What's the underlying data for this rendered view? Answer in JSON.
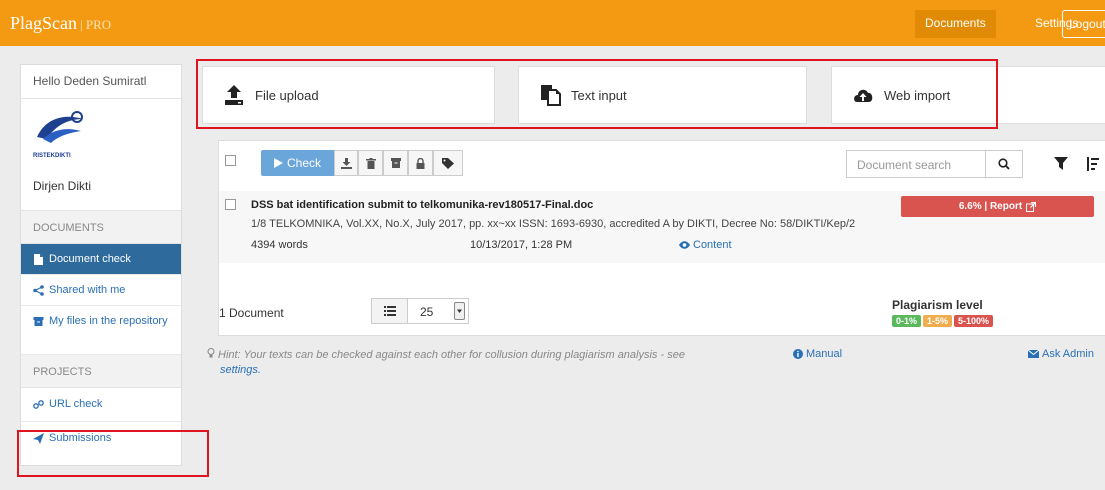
{
  "app": {
    "logo_text": "PlagScan",
    "logo_suffix": "| PRO"
  },
  "topnav": {
    "documents": "Documents",
    "settings": "Settings",
    "logout": "Logout"
  },
  "sidebar": {
    "greeting": "Hello Deden Sumiratl",
    "org_logo_text": "RISTEKDIKTI",
    "org_name": "Dirjen Dikti",
    "documents_header": "DOCUMENTS",
    "items": [
      {
        "label": "Document check",
        "icon": "file-icon",
        "active": true
      },
      {
        "label": "Shared with me",
        "icon": "share-icon",
        "active": false
      },
      {
        "label": "My files in the repository",
        "icon": "archive-icon",
        "active": false
      }
    ],
    "projects_header": "PROJECTS",
    "project_items": [
      {
        "label": "URL check",
        "icon": "link-icon"
      },
      {
        "label": "Submissions",
        "icon": "send-icon"
      }
    ]
  },
  "input_methods": [
    {
      "label": "File upload",
      "icon": "upload-icon"
    },
    {
      "label": "Text input",
      "icon": "paste-icon"
    },
    {
      "label": "Web import",
      "icon": "cloud-upload-icon"
    }
  ],
  "toolbar": {
    "check_label": "Check",
    "search_placeholder": "Document search"
  },
  "document": {
    "title": "DSS bat identification submit to telkomunika-rev180517-Final.doc",
    "meta": "1/8 TELKOMNIKA, Vol.XX, No.X, July 2017, pp. xx~xx ISSN: 1693-6930, accredited A by DIKTI, Decree No: 58/DIKTI/Kep/2",
    "words": "4394  words",
    "date": "10/13/2017, 1:28 PM",
    "content_link": "Content",
    "report_label": "6.6% | Report"
  },
  "footer": {
    "doc_count": "1 Document",
    "page_size": "25",
    "plagiarism_level_title": "Plagiarism level",
    "levels": [
      {
        "label": "0-1%",
        "color": "#5cb85c"
      },
      {
        "label": "1-5%",
        "color": "#f0ad4e"
      },
      {
        "label": "5-100%",
        "color": "#d9534f"
      }
    ]
  },
  "hint": {
    "text": "Hint: Your texts can be checked against each other for collusion during plagiarism analysis - see",
    "link": "settings."
  },
  "links": {
    "manual": "Manual",
    "ask_admin": "Ask Admin"
  },
  "colors": {
    "brand_orange": "#f39a12",
    "active_blue": "#2f6a9d",
    "report_red": "#d9534f",
    "highlight_red": "#e0141e"
  }
}
